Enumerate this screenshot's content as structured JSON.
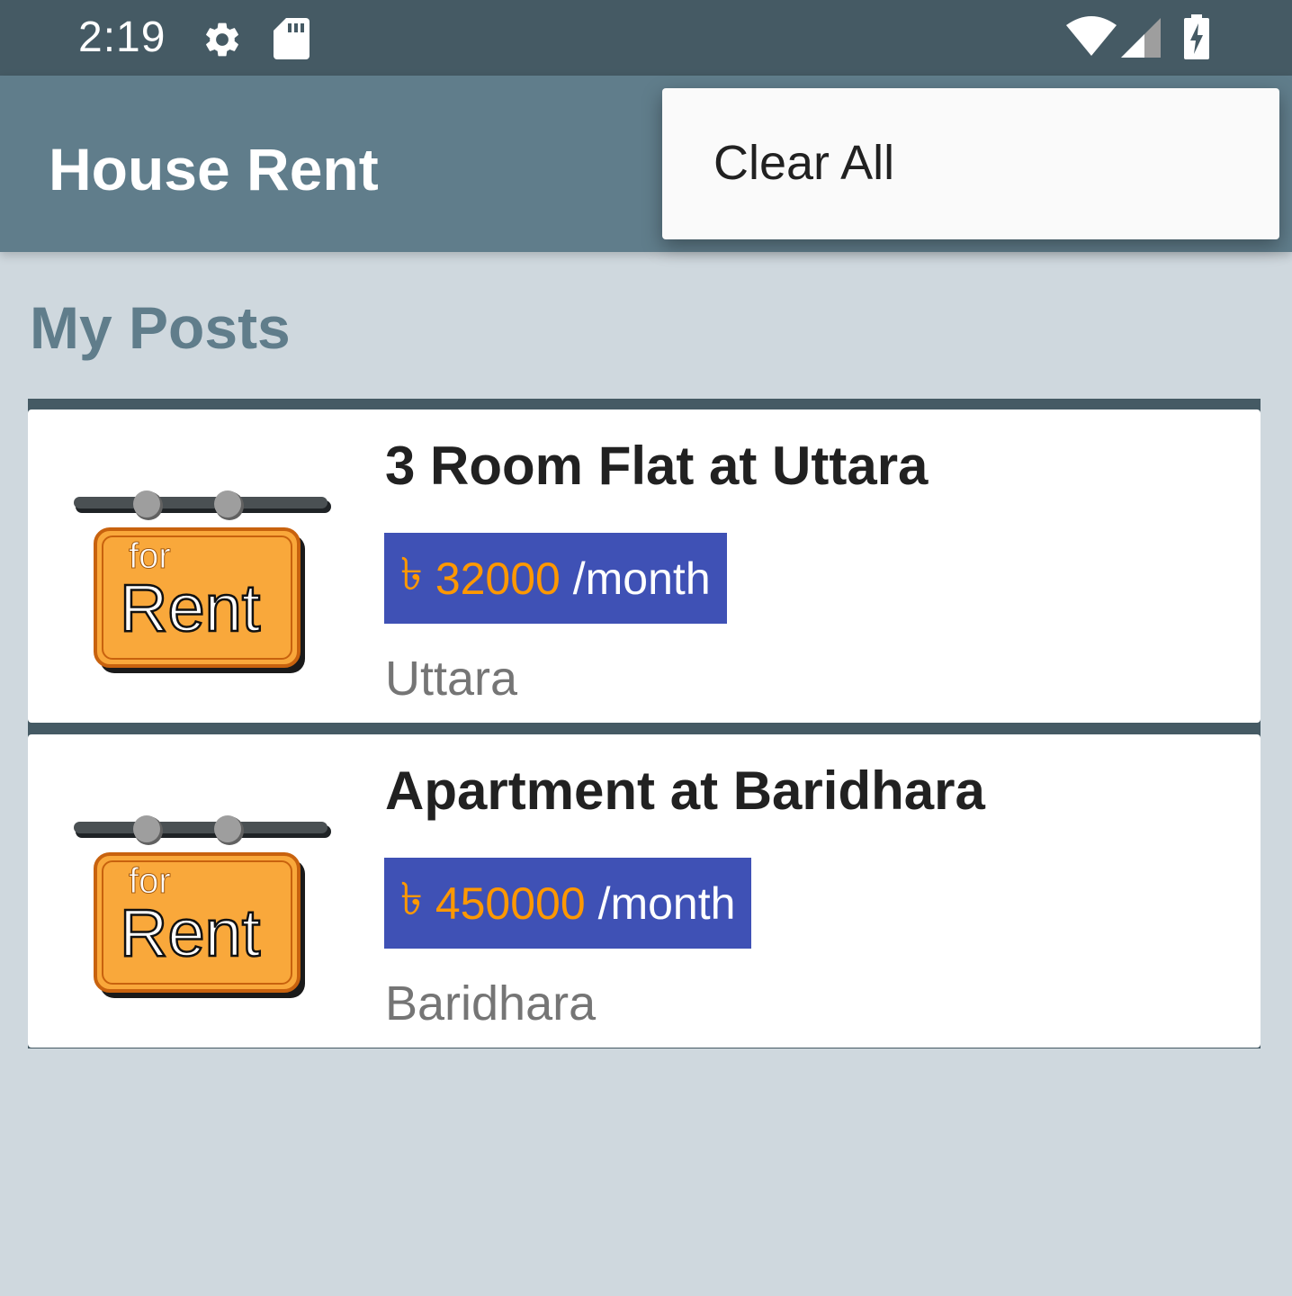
{
  "status_bar": {
    "time": "2:19"
  },
  "app_bar": {
    "title": "House Rent"
  },
  "overflow_menu": {
    "items": [
      {
        "label": "Clear All"
      }
    ]
  },
  "section": {
    "title": "My Posts"
  },
  "posts": [
    {
      "title": "3 Room Flat at Uttara",
      "currency": "৳",
      "price": "32000",
      "unit": "/month",
      "location": "Uttara",
      "sign_top": "for",
      "sign_main": "Rent"
    },
    {
      "title": "Apartment at Baridhara",
      "currency": "৳",
      "price": "450000",
      "unit": "/month",
      "location": "Baridhara",
      "sign_top": "for",
      "sign_main": "Rent"
    }
  ],
  "colors": {
    "status_bar": "#455a64",
    "app_bar": "#607d8b",
    "price_badge": "#3f51b5",
    "price_text": "#ff9800",
    "background": "#cfd8de"
  }
}
